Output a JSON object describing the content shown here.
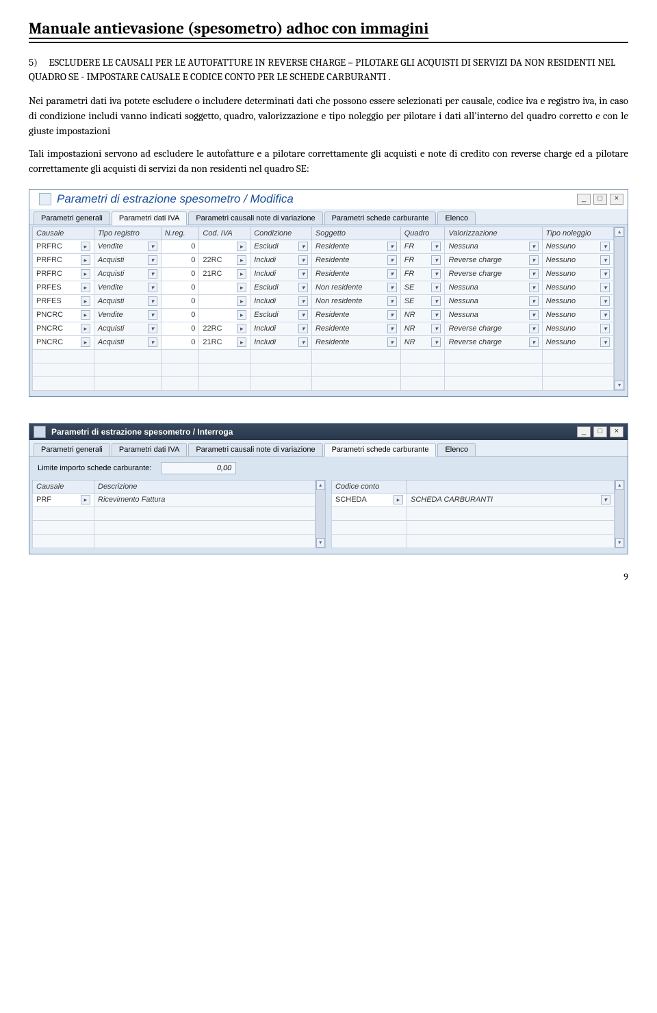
{
  "doc": {
    "title": "Manuale antievasione (spesometro) adhoc con immagini",
    "section_num": "5)",
    "section_heading": "ESCLUDERE LE CAUSALI PER LE AUTOFATTURE IN REVERSE CHARGE – PILOTARE GLI ACQUISTI DI SERVIZI DA NON RESIDENTI NEL QUADRO SE - IMPOSTARE CAUSALE E CODICE CONTO PER LE SCHEDE CARBURANTI .",
    "para1": "Nei parametri dati iva potete escludere o includere determinati dati che possono essere selezionati per causale, codice iva e registro iva, in caso di condizione includi vanno indicati soggetto, quadro, valorizzazione e tipo noleggio per pilotare i dati all'interno del quadro corretto  e con le giuste impostazioni",
    "para2": "Tali impostazioni servono ad escludere le autofatture e a pilotare correttamente gli acquisti e note di credito con reverse charge ed a pilotare correttamente gli acquisti di servizi da non residenti nel quadro SE:",
    "page_number": "9"
  },
  "win1": {
    "title": "Parametri di estrazione spesometro / Modifica",
    "tabs": [
      "Parametri generali",
      "Parametri dati IVA",
      "Parametri causali note di variazione",
      "Parametri schede carburante",
      "Elenco"
    ],
    "active_tab": 1,
    "headers": [
      "Causale",
      "Tipo registro",
      "N.reg.",
      "Cod. IVA",
      "Condizione",
      "Soggetto",
      "Quadro",
      "Valorizzazione",
      "Tipo noleggio"
    ],
    "rows": [
      {
        "causale": "PRFRC",
        "tiporeg": "Vendite",
        "nreg": "0",
        "codiva": "",
        "cond": "Escludi",
        "sogg": "Residente",
        "quadro": "FR",
        "valor": "Nessuna",
        "tipon": "Nessuno"
      },
      {
        "causale": "PRFRC",
        "tiporeg": "Acquisti",
        "nreg": "0",
        "codiva": "22RC",
        "cond": "Includi",
        "sogg": "Residente",
        "quadro": "FR",
        "valor": "Reverse charge",
        "tipon": "Nessuno"
      },
      {
        "causale": "PRFRC",
        "tiporeg": "Acquisti",
        "nreg": "0",
        "codiva": "21RC",
        "cond": "Includi",
        "sogg": "Residente",
        "quadro": "FR",
        "valor": "Reverse charge",
        "tipon": "Nessuno"
      },
      {
        "causale": "PRFES",
        "tiporeg": "Vendite",
        "nreg": "0",
        "codiva": "",
        "cond": "Escludi",
        "sogg": "Non residente",
        "quadro": "SE",
        "valor": "Nessuna",
        "tipon": "Nessuno"
      },
      {
        "causale": "PRFES",
        "tiporeg": "Acquisti",
        "nreg": "0",
        "codiva": "",
        "cond": "Includi",
        "sogg": "Non residente",
        "quadro": "SE",
        "valor": "Nessuna",
        "tipon": "Nessuno"
      },
      {
        "causale": "PNCRC",
        "tiporeg": "Vendite",
        "nreg": "0",
        "codiva": "",
        "cond": "Escludi",
        "sogg": "Residente",
        "quadro": "NR",
        "valor": "Nessuna",
        "tipon": "Nessuno"
      },
      {
        "causale": "PNCRC",
        "tiporeg": "Acquisti",
        "nreg": "0",
        "codiva": "22RC",
        "cond": "Includi",
        "sogg": "Residente",
        "quadro": "NR",
        "valor": "Reverse charge",
        "tipon": "Nessuno"
      },
      {
        "causale": "PNCRC",
        "tiporeg": "Acquisti",
        "nreg": "0",
        "codiva": "21RC",
        "cond": "Includi",
        "sogg": "Residente",
        "quadro": "NR",
        "valor": "Reverse charge",
        "tipon": "Nessuno"
      }
    ],
    "empty_rows": 3
  },
  "win2": {
    "title": "Parametri di estrazione spesometro / Interroga",
    "tabs": [
      "Parametri generali",
      "Parametri dati IVA",
      "Parametri causali note di variazione",
      "Parametri schede carburante",
      "Elenco"
    ],
    "active_tab": 3,
    "limit_label": "Limite importo schede carburante:",
    "limit_value": "0,00",
    "left_headers": [
      "Causale",
      "Descrizione"
    ],
    "left_rows": [
      {
        "causale": "PRF",
        "descr": "Ricevimento Fattura"
      }
    ],
    "right_headers": [
      "Codice conto",
      ""
    ],
    "right_rows": [
      {
        "cod": "SCHEDA",
        "descr": "SCHEDA CARBURANTI"
      }
    ]
  },
  "win_btns": {
    "min": "_",
    "max": "□",
    "close": "×"
  }
}
